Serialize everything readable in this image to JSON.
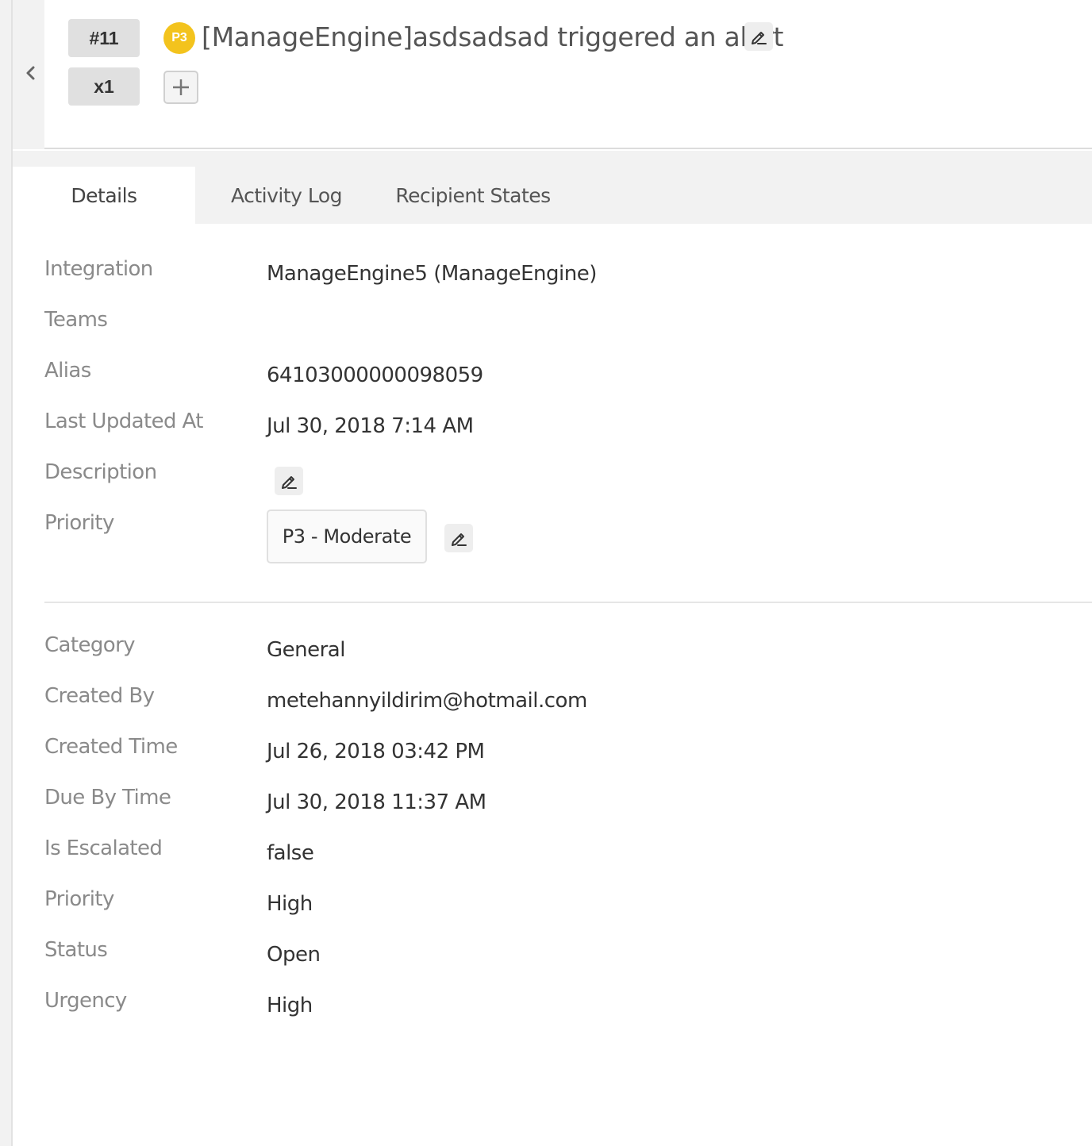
{
  "header": {
    "alert_id": "#11",
    "count": "x1",
    "priority_badge": "P3",
    "title": "[ManageEngine]asdsadsad triggered an alert",
    "priority_color": "#f3c31d"
  },
  "tabs": [
    {
      "label": "Details",
      "active": true
    },
    {
      "label": "Activity Log",
      "active": false
    },
    {
      "label": "Recipient States",
      "active": false
    }
  ],
  "details": {
    "integration": {
      "label": "Integration",
      "value": "ManageEngine5 (ManageEngine)"
    },
    "teams": {
      "label": "Teams",
      "value": ""
    },
    "alias": {
      "label": "Alias",
      "value": "64103000000098059"
    },
    "last_updated": {
      "label": "Last Updated At",
      "value": "Jul 30, 2018 7:14 AM"
    },
    "description": {
      "label": "Description",
      "value": ""
    },
    "priority": {
      "label": "Priority",
      "value": "P3 - Moderate"
    }
  },
  "extra": {
    "category": {
      "label": "Category",
      "value": "General"
    },
    "created_by": {
      "label": "Created By",
      "value": "metehannyildirim@hotmail.com"
    },
    "created_time": {
      "label": "Created Time",
      "value": "Jul 26, 2018 03:42 PM"
    },
    "due_by_time": {
      "label": "Due By Time",
      "value": "Jul 30, 2018 11:37 AM"
    },
    "is_escalated": {
      "label": "Is Escalated",
      "value": "false"
    },
    "priority": {
      "label": "Priority",
      "value": "High"
    },
    "status": {
      "label": "Status",
      "value": "Open"
    },
    "urgency": {
      "label": "Urgency",
      "value": "High"
    }
  },
  "icons": {
    "back": "chevron-left-icon",
    "edit": "pencil-icon",
    "add": "plus-icon"
  }
}
